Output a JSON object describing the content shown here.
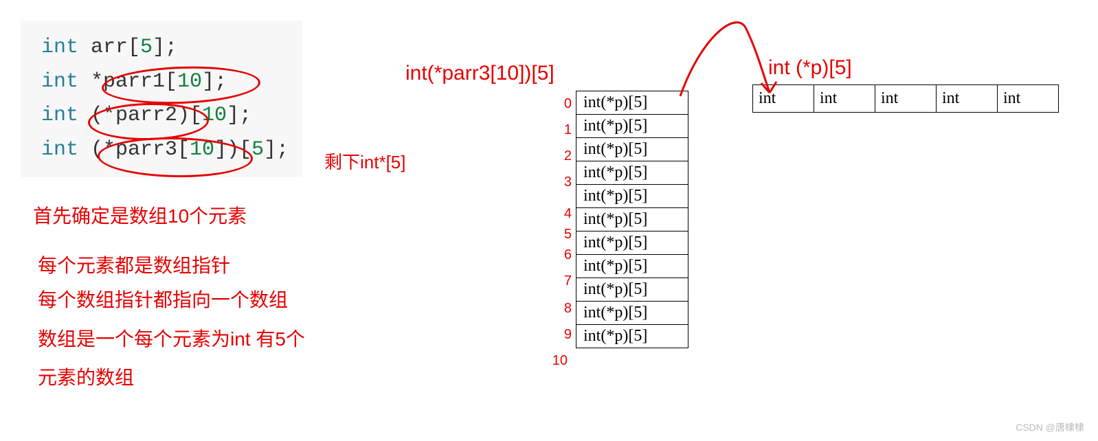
{
  "code": {
    "line1_kw": "int",
    "line1_rest": " arr[5];",
    "line2_kw": "int",
    "line2_rest": " *parr1[10];",
    "line3_kw": "int",
    "line3_rest": " (*parr2)[10];",
    "line4_kw": "int",
    "line4_rest": " (*parr3[10])[5];"
  },
  "notes": {
    "remain": "剩下int*[5]",
    "n1": "首先确定是数组10个元素",
    "n2": "每个元素都是数组指针",
    "n3": "每个数组指针都指向一个数组",
    "n4": "数组是一个每个元素为int 有5个",
    "n5": "元素的数组"
  },
  "headings": {
    "parr3": "int(*parr3[10])[5]",
    "intp5": "int (*p)[5]"
  },
  "vrows": {
    "cell": "int(*p)[5]",
    "indices": [
      "0",
      "1",
      "2",
      "3",
      "4",
      "5",
      "6",
      "7",
      "8",
      "9",
      "10"
    ]
  },
  "hrow": {
    "cell": "int"
  },
  "watermark": "CSDN @唐棣棣"
}
